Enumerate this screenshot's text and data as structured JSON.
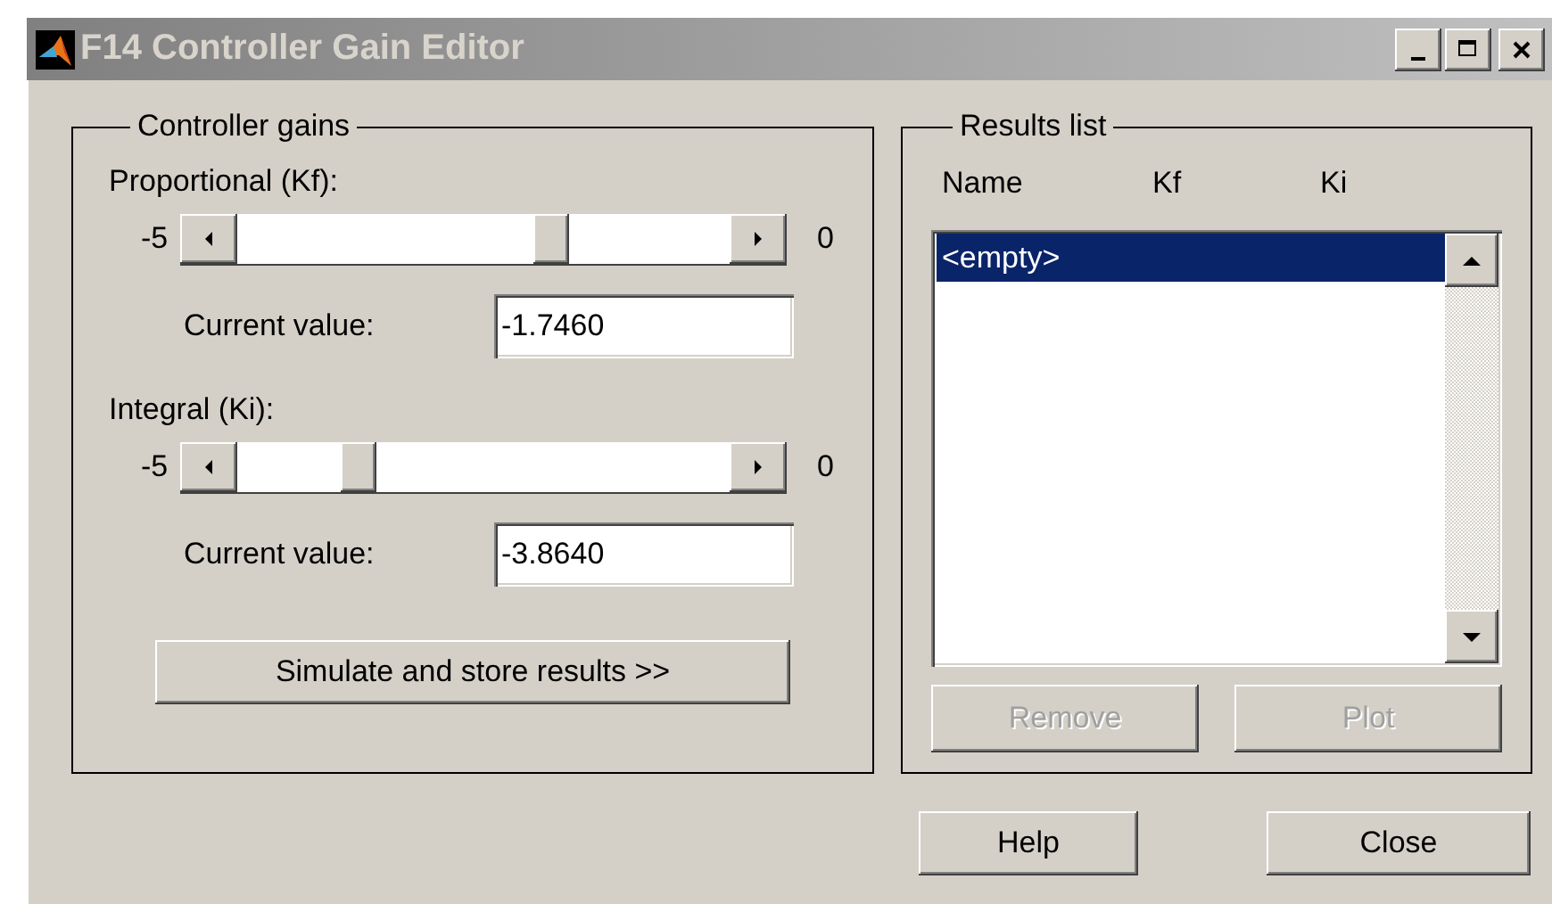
{
  "window": {
    "title": "F14 Controller Gain Editor"
  },
  "gains": {
    "label": "Controller gains",
    "controls": [
      {
        "label": "Proportional (Kf):",
        "min_label": "-5",
        "max_label": "0",
        "level": 0.65,
        "value_label": "Current value:",
        "value": "-1.7460"
      },
      {
        "label": "Integral (Ki):",
        "min_label": "-5",
        "max_label": "0",
        "level": 0.227,
        "value_label": "Current value:",
        "value": "-3.8640"
      }
    ],
    "simulate_button": "Simulate and store results >>"
  },
  "results": {
    "label": "Results list",
    "columns": [
      "Name",
      "Kf",
      "Ki"
    ],
    "items": [
      {
        "text": "<empty>",
        "selected": true
      }
    ],
    "buttons": [
      {
        "label": "Remove",
        "disabled": true
      },
      {
        "label": "Plot",
        "disabled": true
      }
    ]
  },
  "buttons": [
    {
      "label": "Help"
    },
    {
      "label": "Close"
    }
  ]
}
